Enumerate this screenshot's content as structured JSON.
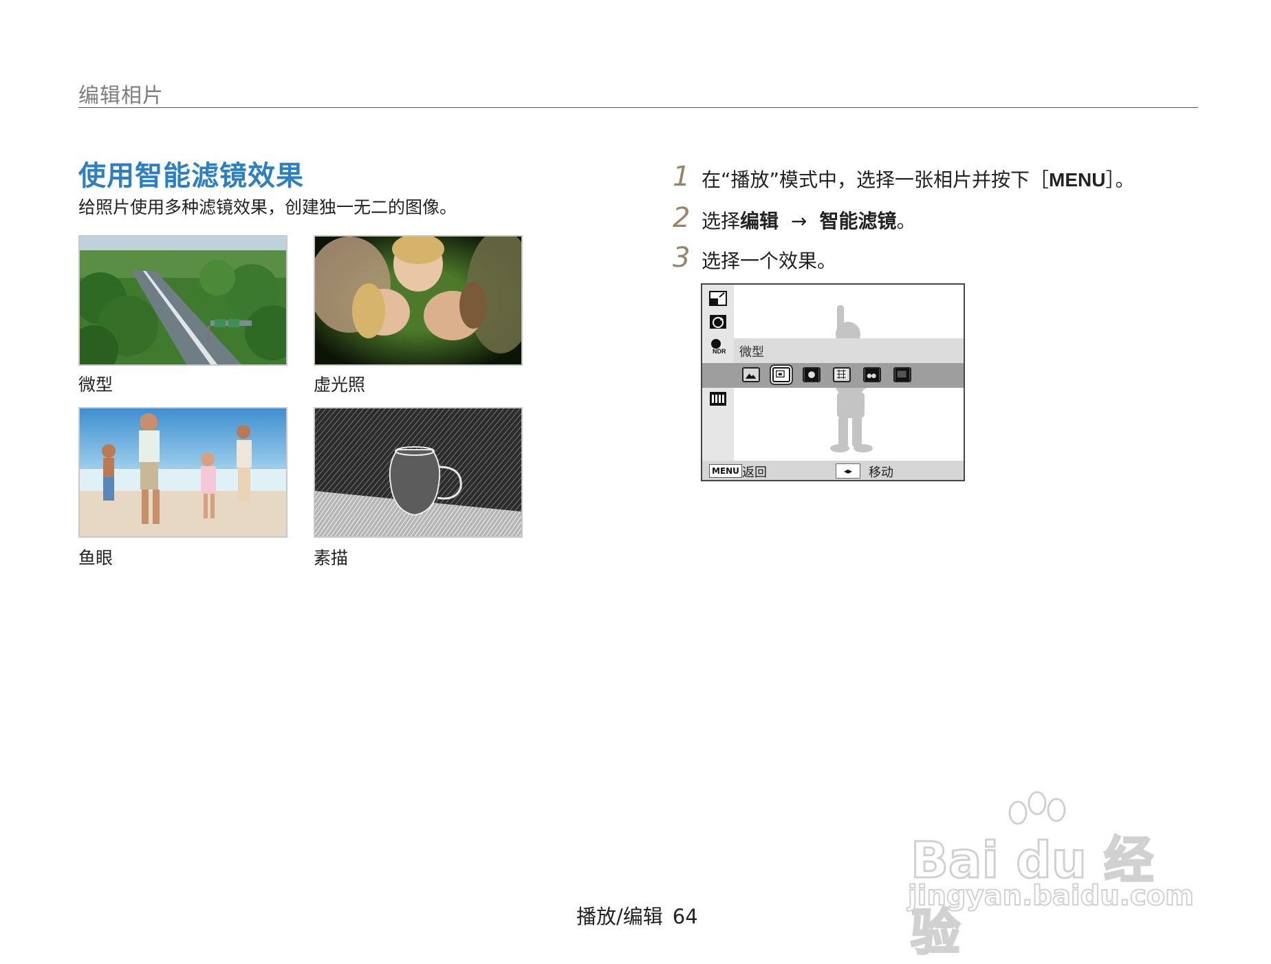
{
  "header": {
    "section_title": "编辑相片"
  },
  "main": {
    "heading": "使用智能滤镜效果",
    "intro": "给照片使用多种滤镜效果，创建独一无二的图像。",
    "examples": [
      {
        "caption": "微型",
        "image": "miniature-highway-photo"
      },
      {
        "caption": "虚光照",
        "image": "vignette-people-on-grass-photo"
      },
      {
        "caption": "鱼眼",
        "image": "fisheye-family-beach-photo"
      },
      {
        "caption": "素描",
        "image": "sketch-glass-pitcher-photo"
      }
    ]
  },
  "steps": [
    {
      "num": "1",
      "pre": "在“播放”模式中，选择一张相片并按下［",
      "key": "MENU",
      "post": "］。"
    },
    {
      "num": "2",
      "pre": "选择",
      "b1": "编辑",
      "arrow": "→",
      "b2": "智能滤镜",
      "post": "。"
    },
    {
      "num": "3",
      "text": "选择一个效果。"
    }
  ],
  "camera_screen": {
    "sidebar_icons": [
      "resize-icon",
      "rotate-icon",
      "acb-icon",
      "smart-filter-icon",
      "image-adjust-icon"
    ],
    "effect_label": "微型",
    "effect_icons": [
      "normal-icon",
      "miniature-icon",
      "vignette-icon",
      "fisheye-icon",
      "sketch-icon",
      "defog-icon",
      "frame-icon"
    ],
    "selected_effect": "miniature-icon",
    "menu_key": "MENU",
    "back_label": "返回",
    "dpad_key": "◂▸",
    "move_label": "移动"
  },
  "footer": {
    "section": "播放/编辑",
    "page_number": "64"
  },
  "watermark": {
    "brand": "Bai du 经验",
    "url": "jingyan.baidu.com"
  },
  "colors": {
    "heading": "#2b7fc4",
    "step_number": "#9a8468",
    "rule": "#555555"
  }
}
